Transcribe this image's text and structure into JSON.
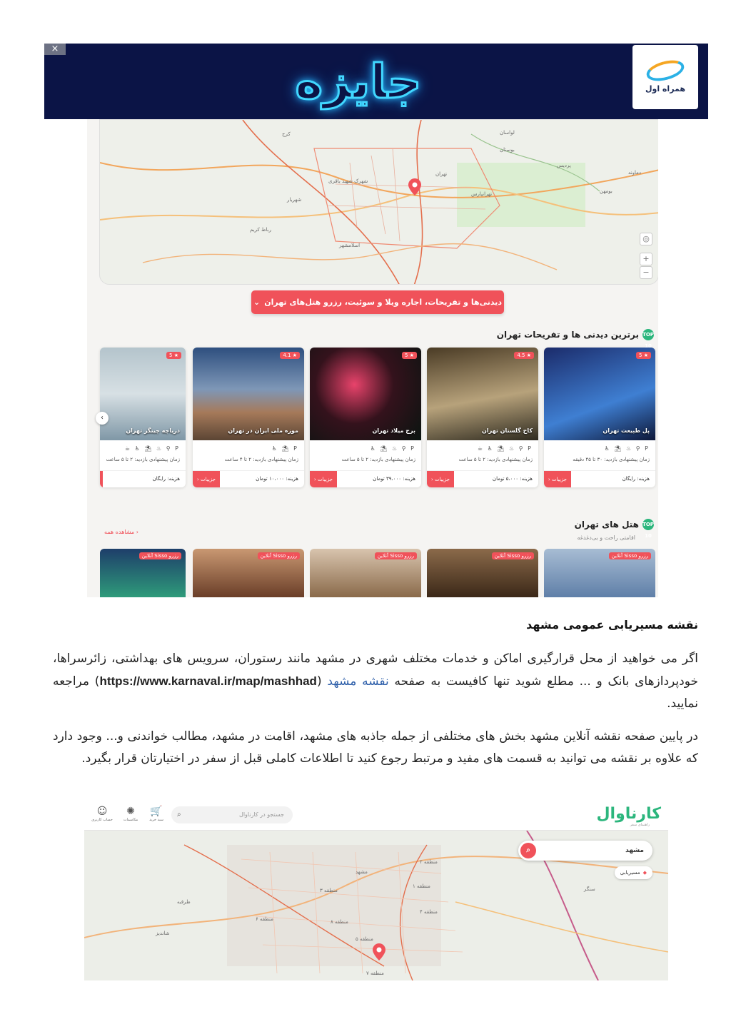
{
  "banner": {
    "close_label": "×",
    "title": "جایزه",
    "logo_text": "همراه اول"
  },
  "tehran_map": {
    "labels": [
      "کرج",
      "شهریار",
      "تهران",
      "اسلامشهر",
      "رباط کریم",
      "لواسان",
      "پردیس",
      "بومهن",
      "دماوند",
      "شهرک شهید باقری",
      "بوستان",
      "تهرانپارس"
    ],
    "zoom_in": "+",
    "zoom_out": "−"
  },
  "cta_button": "دیدنی‌ها و تفریحات، اجاره ویلا و سوئیت، رزرو هتل‌های تهران",
  "attractions": {
    "title": "برترین دیدنی ها و تفریحات تهران",
    "badge": "TOP 10",
    "cards": [
      {
        "name": "پل طبیعت تهران",
        "rating": "5",
        "icons": "P ⚲ ♨ ⛱ ♿",
        "time": "زمان پیشنهادی بازدید: ۳۰ تا ۴۵ دقیقه",
        "cost": "هزینه: رایگان",
        "more": "جزییات",
        "color1": "#1b2b6a",
        "color2": "#3f7fd2"
      },
      {
        "name": "کاخ گلستان تهران",
        "rating": "4.5",
        "icons": "P ⚲ ♨ ⛱ ♿ ☕",
        "time": "زمان پیشنهادی بازدید: ۲ تا ۵ ساعت",
        "cost": "هزینه: ۵،۰۰۰ تومان",
        "more": "جزییات",
        "color1": "#6d5a3b",
        "color2": "#b7a27b"
      },
      {
        "name": "برج میلاد تهران",
        "rating": "5",
        "icons": "P ⚲ ♨ ⛱ ♿",
        "time": "زمان پیشنهادی بازدید: ۲ تا ۵ ساعت",
        "cost": "هزینه: ۳۹،۰۰۰ تومان",
        "more": "جزییات",
        "color1": "#0c1b12",
        "color2": "#cf2a55"
      },
      {
        "name": "موزه ملی ایران در تهران",
        "rating": "4.1",
        "icons": "P ⛱ ♿",
        "time": "زمان پیشنهادی بازدید: ۲ تا ۴ ساعت",
        "cost": "هزینه: ۱۰،۰۰۰ تومان",
        "more": "جزییات",
        "color1": "#2e4f7f",
        "color2": "#a67a5a"
      },
      {
        "name": "دریاچه چیتگر تهران",
        "rating": "5",
        "icons": "P ⚲ ♨ ⛱ ♿ ☕",
        "time": "زمان پیشنهادی بازدید: ۲ تا ۵ ساعت",
        "cost": "هزینه: رایگان",
        "more": "جزییات",
        "color1": "#7f97a6",
        "color2": "#d7e0e4"
      }
    ]
  },
  "hotels": {
    "title": "هتل های تهران",
    "subtitle": "اقامتی راحت و بی‌دغدغه",
    "see_all": "مشاهده همه",
    "badge": "رزرو Sisso آنلاین",
    "colors": [
      "#5f7fa8",
      "#6b4a2d",
      "#8a6a4a",
      "#a66a50",
      "#1e3e6a"
    ]
  },
  "article": {
    "heading": "نقشه مسیریابی عمومی مشهد",
    "p1_text": "اگر می خواهید از محل قرارگیری اماکن و خدمات مختلف شهری در مشهد مانند رستوران، سرویس های بهداشتی، زائرسراها، خودپردازهای بانک و ... مطلع شوید تنها کافیست به صفحه",
    "p1_link": "نقشه مشهد",
    "p1_url": "https://www.karnaval.ir/map/mashhad",
    "p1_end": "مراجعه نمایید.",
    "p2": "در پایین صفحه نقشه آنلاین مشهد بخش های مختلفی از جمله جاذبه های مشهد، اقامت در مشهد، مطالب خواندنی و... وجود دارد که علاوه بر نقشه می توانید به قسمت های مفید و مرتبط رجوع کنید تا اطلاعات کاملی قبل از سفر در اختیارتان قرار بگیرد."
  },
  "mashhad_app": {
    "logo": "کارناوال",
    "logo_sub": "راهنمای سفر",
    "search_placeholder": "جستجو در کارناوال",
    "icons": [
      {
        "glyph": "☺",
        "label": "حساب کاربری"
      },
      {
        "glyph": "✺",
        "label": "مکاسمات"
      },
      {
        "glyph": "🛒",
        "label": "سبد خرید"
      }
    ],
    "map_search_value": "مشهد",
    "route_label": "مسیریابی",
    "map_labels": [
      "مشهد",
      "منطقه ۱",
      "منطقه ۲",
      "منطقه ۳",
      "منطقه ۴",
      "منطقه ۵",
      "منطقه ۶",
      "منطقه ۷",
      "منطقه ۸",
      "طرقبه",
      "شاندیز",
      "سنگر"
    ]
  }
}
